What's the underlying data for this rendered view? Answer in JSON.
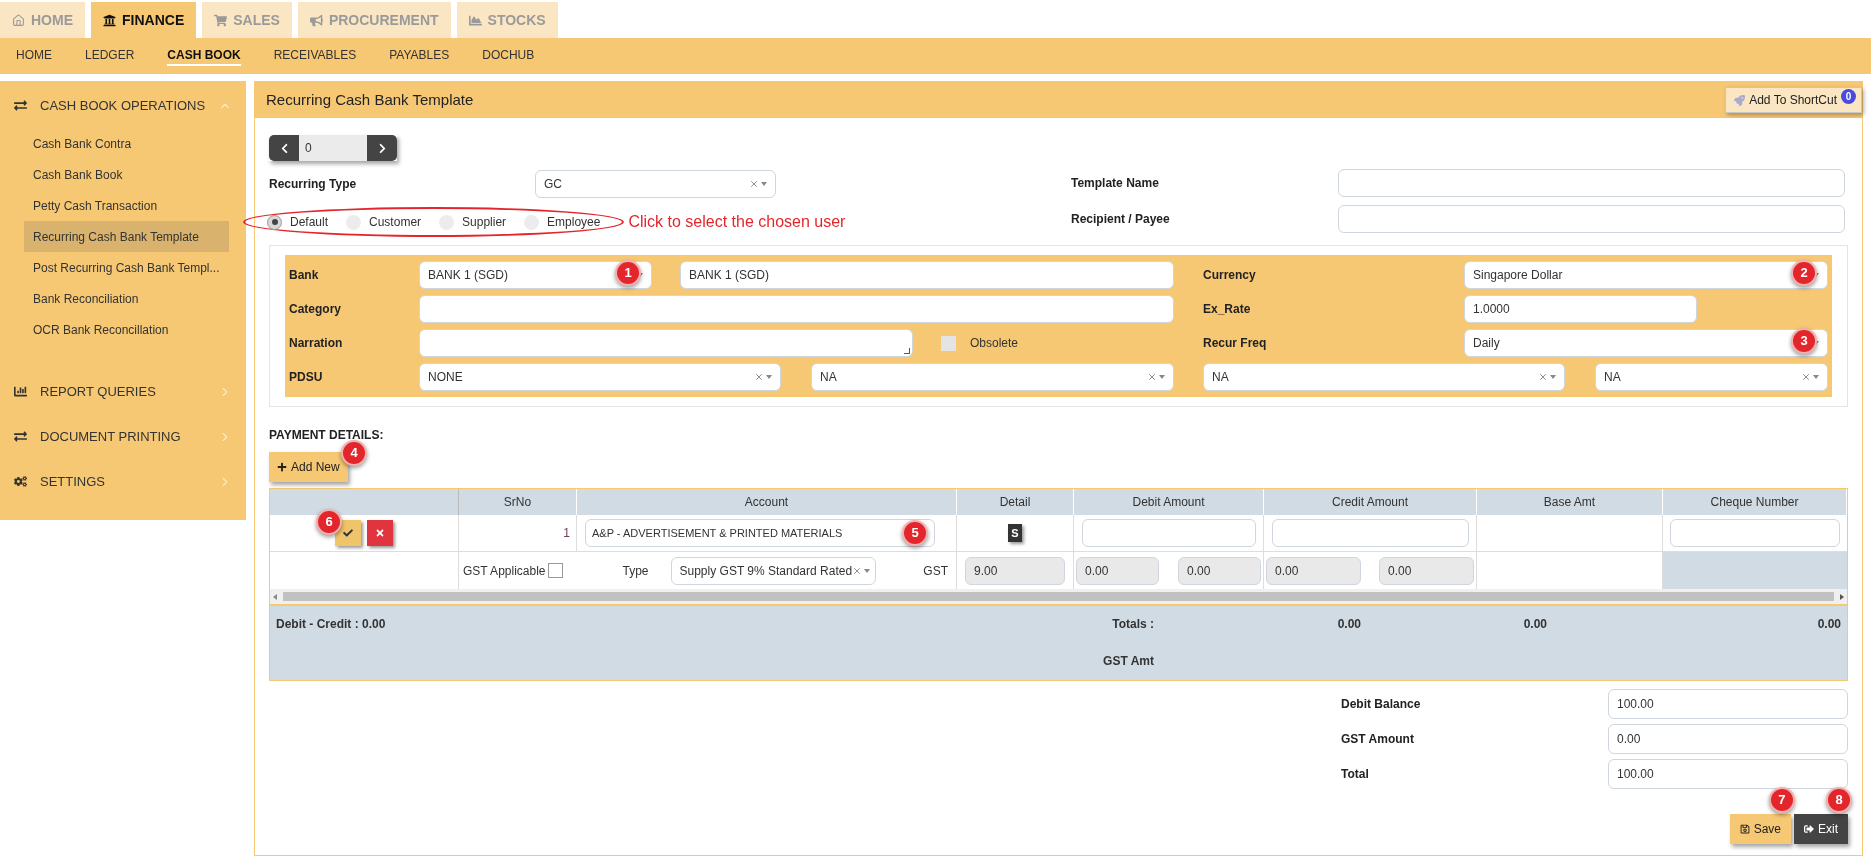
{
  "top_tabs": [
    {
      "label": "HOME",
      "selected": false
    },
    {
      "label": "FINANCE",
      "selected": true
    },
    {
      "label": "SALES",
      "selected": false
    },
    {
      "label": "PROCUREMENT",
      "selected": false
    },
    {
      "label": "STOCKS",
      "selected": false
    }
  ],
  "sub_nav": [
    {
      "label": "HOME",
      "selected": false
    },
    {
      "label": "LEDGER",
      "selected": false
    },
    {
      "label": "CASH BOOK",
      "selected": true
    },
    {
      "label": "RECEIVABLES",
      "selected": false
    },
    {
      "label": "PAYABLES",
      "selected": false
    },
    {
      "label": "DOCHUB",
      "selected": false
    }
  ],
  "sidebar": {
    "sections": [
      {
        "title": "CASH BOOK OPERATIONS",
        "expanded": true,
        "items": [
          {
            "label": "Cash Bank Contra",
            "selected": false
          },
          {
            "label": "Cash Bank Book",
            "selected": false
          },
          {
            "label": "Petty Cash Transaction",
            "selected": false
          },
          {
            "label": "Recurring Cash Bank Template",
            "selected": true
          },
          {
            "label": "Post Recurring Cash Bank Templ...",
            "selected": false
          },
          {
            "label": "Bank Reconciliation",
            "selected": false
          },
          {
            "label": "OCR Bank Reconcillation",
            "selected": false
          }
        ]
      },
      {
        "title": "REPORT QUERIES",
        "expanded": false
      },
      {
        "title": "DOCUMENT PRINTING",
        "expanded": false
      },
      {
        "title": "SETTINGS",
        "expanded": false
      }
    ]
  },
  "page": {
    "title": "Recurring Cash Bank Template",
    "shortcut_button": {
      "label": "Add To ShortCut",
      "badge": "0"
    },
    "pager_value": "0"
  },
  "form": {
    "recurring_type": {
      "label": "Recurring Type",
      "value": "GC"
    },
    "user_options": [
      {
        "label": "Default",
        "selected": true
      },
      {
        "label": "Customer",
        "selected": false
      },
      {
        "label": "Supplier",
        "selected": false
      },
      {
        "label": "Employee",
        "selected": false
      }
    ],
    "annotation": "Click to select the chosen user",
    "template_name": {
      "label": "Template Name"
    },
    "recipient": {
      "label": "Recipient / Payee"
    }
  },
  "bank_panel": {
    "bank": {
      "label": "Bank",
      "value": "BANK 1 (SGD)",
      "name_value": "BANK 1 (SGD)",
      "callout": "1"
    },
    "currency": {
      "label": "Currency",
      "value": "Singapore Dollar",
      "callout": "2"
    },
    "category": {
      "label": "Category"
    },
    "ex_rate": {
      "label": "Ex_Rate",
      "value": "1.0000"
    },
    "narration": {
      "label": "Narration"
    },
    "obsolete": {
      "label": "Obsolete",
      "checked": false
    },
    "recur_freq": {
      "label": "Recur Freq",
      "value": "Daily",
      "callout": "3"
    },
    "pdsu": {
      "label": "PDSU",
      "values": [
        "NONE",
        "NA",
        "NA",
        "NA"
      ]
    }
  },
  "payment_details": {
    "title": "PAYMENT DETAILS:",
    "add_new": {
      "label": "Add New",
      "callout": "4"
    },
    "columns": [
      "SrNo",
      "Account",
      "Detail",
      "Debit Amount",
      "Credit Amount",
      "Base Amt",
      "Cheque Number"
    ],
    "row": {
      "action_callout": "6",
      "srno": "1",
      "account": "A&P - ADVERTISEMENT & PRINTED MATERIALS",
      "account_callout": "5",
      "detail": "S"
    },
    "gst_row": {
      "gst_applicable": {
        "label": "GST Applicable",
        "checked": false
      },
      "type_label": "Type",
      "type_value": "Supply GST 9% Standard Rated",
      "gst_label": "GST",
      "gst_value": "9.00",
      "amounts": [
        "0.00",
        "0.00",
        "0.00",
        "0.00"
      ]
    },
    "totals": {
      "difference": "Debit - Credit : 0.00",
      "label": "Totals :",
      "values": [
        "0.00",
        "0.00",
        "0.00"
      ],
      "gst_amt_label": "GST Amt"
    }
  },
  "summary": [
    {
      "label": "Debit Balance",
      "value": "100.00"
    },
    {
      "label": "GST Amount",
      "value": "0.00"
    },
    {
      "label": "Total",
      "value": "100.00"
    }
  ],
  "buttons": [
    {
      "kind": "save",
      "label": "Save",
      "callout": "7"
    },
    {
      "kind": "exit",
      "label": "Exit",
      "callout": "8"
    }
  ]
}
